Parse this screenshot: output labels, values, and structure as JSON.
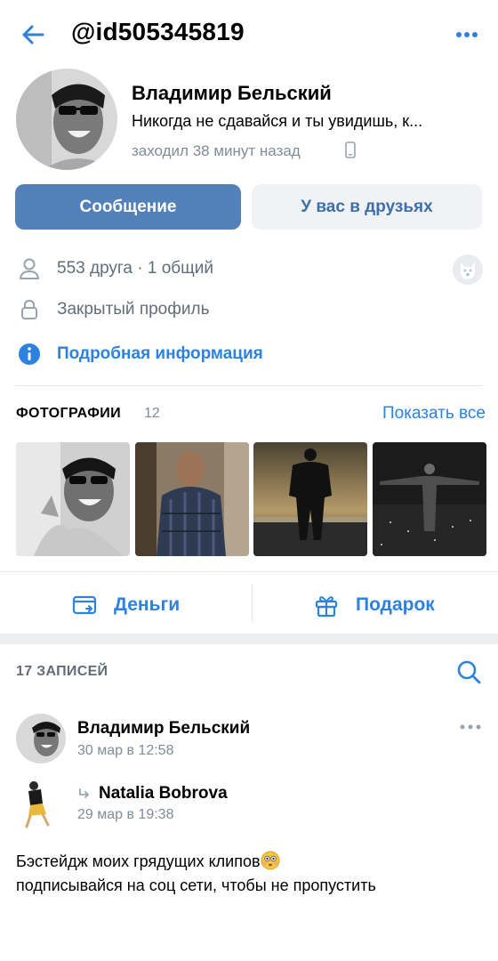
{
  "header": {
    "handle": "@id505345819"
  },
  "profile": {
    "name": "Владимир Бельский",
    "status": "Никогда не сдавайся и ты увидишь, к...",
    "last_seen": "заходил 38 минут назад"
  },
  "buttons": {
    "message": "Сообщение",
    "friends": "У вас в друзьях"
  },
  "info": {
    "friends": "553 друга · 1 общий",
    "closed": "Закрытый профиль",
    "details": "Подробная информация"
  },
  "photos": {
    "title": "ФОТОГРАФИИ",
    "count": "12",
    "show_all": "Показать все"
  },
  "actions": {
    "money": "Деньги",
    "gift": "Подарок"
  },
  "posts": {
    "title": "17 ЗАПИСЕЙ",
    "author": "Владимир Бельский",
    "date": "30 мар в 12:58",
    "repost_author": "Natalia Bobrova",
    "repost_date": "29 мар в 19:38",
    "text_line1": "Бэстейдж моих грядущих клипов",
    "text_line2": "подписывайся на соц сети, чтобы не пропустить"
  },
  "colors": {
    "accent": "#2d81e0",
    "primary_button": "#5181b8",
    "secondary_text": "#818c99"
  }
}
